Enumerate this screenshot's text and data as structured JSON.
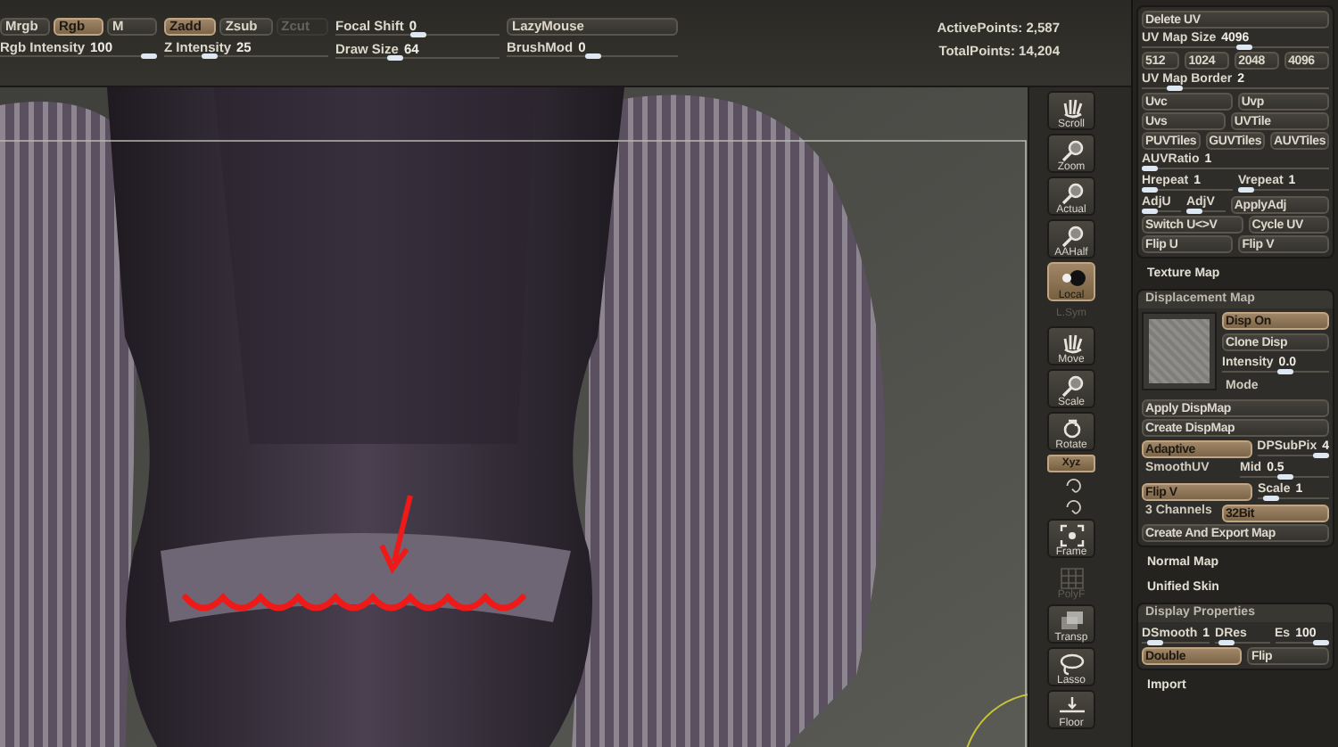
{
  "top_bar": {
    "groups": [
      {
        "rows": [
          {
            "cells": [
              {
                "kind": "button",
                "label": "Mrgb",
                "selected": false,
                "disabled": false
              },
              {
                "kind": "button",
                "label": "Rgb",
                "selected": true,
                "disabled": false
              },
              {
                "kind": "button",
                "label": "M",
                "selected": false,
                "disabled": false
              }
            ]
          },
          {
            "cells": [
              {
                "kind": "slider",
                "label": "Rgb Intensity",
                "value": "100",
                "level": 1
              }
            ]
          }
        ]
      },
      {
        "rows": [
          {
            "cells": [
              {
                "kind": "button",
                "label": "Zadd",
                "selected": true,
                "disabled": false
              },
              {
                "kind": "button",
                "label": "Zsub",
                "selected": false,
                "disabled": false
              },
              {
                "kind": "button",
                "label": "Zcut",
                "selected": false,
                "disabled": true
              }
            ]
          },
          {
            "cells": [
              {
                "kind": "slider",
                "label": "Z Intensity",
                "value": "25",
                "level": 0.25
              }
            ]
          }
        ]
      },
      {
        "rows": [
          {
            "cells": [
              {
                "kind": "slider",
                "label": "Focal Shift",
                "value": "0",
                "level": 0.5
              }
            ]
          },
          {
            "cells": [
              {
                "kind": "slider",
                "label": "Draw Size",
                "value": "64",
                "level": 0.35
              }
            ]
          }
        ]
      },
      {
        "rows": [
          {
            "cells": [
              {
                "kind": "button",
                "label": "LazyMouse",
                "selected": false,
                "disabled": false
              }
            ]
          },
          {
            "cells": [
              {
                "kind": "slider",
                "label": "BrushMod",
                "value": "0",
                "level": 0.5
              }
            ]
          }
        ]
      }
    ],
    "stats": [
      "ActivePoints: 2,587",
      "TotalPoints: 14,204"
    ]
  },
  "toolbar": [
    {
      "kind": "big",
      "label": "Scroll",
      "selected": false,
      "disabled": false
    },
    {
      "kind": "big",
      "label": "Zoom",
      "selected": false,
      "disabled": false
    },
    {
      "kind": "big",
      "label": "Actual",
      "selected": false,
      "disabled": false
    },
    {
      "kind": "big",
      "label": "AAHalf",
      "selected": false,
      "disabled": false
    },
    {
      "kind": "big",
      "label": "Local",
      "selected": true,
      "disabled": false
    },
    {
      "kind": "small",
      "label": "L.Sym",
      "selected": false,
      "disabled": true
    },
    {
      "kind": "big",
      "label": "Move",
      "selected": false,
      "disabled": false
    },
    {
      "kind": "big",
      "label": "Scale",
      "selected": false,
      "disabled": false
    },
    {
      "kind": "big",
      "label": "Rotate",
      "selected": false,
      "disabled": false
    },
    {
      "kind": "small",
      "label": "Xyz",
      "selected": true,
      "disabled": false
    },
    {
      "kind": "icon"
    },
    {
      "kind": "icon"
    },
    {
      "kind": "big",
      "label": "Frame",
      "selected": false,
      "disabled": false
    },
    {
      "kind": "big",
      "label": "PolyF",
      "selected": false,
      "disabled": true
    },
    {
      "kind": "big",
      "label": "Transp",
      "selected": false,
      "disabled": false
    },
    {
      "kind": "big",
      "label": "Lasso",
      "selected": false,
      "disabled": false
    },
    {
      "kind": "big",
      "label": "Floor",
      "selected": false,
      "disabled": false
    }
  ],
  "right_panel": [
    {
      "kind": "group",
      "rows": [
        {
          "cells": [
            {
              "kind": "button",
              "label": "Delete UV",
              "selected": false
            }
          ]
        },
        {
          "cells": [
            {
              "kind": "slider",
              "label": "UV Map Size",
              "value": "4096",
              "level": 0.55
            }
          ]
        },
        {
          "cells": [
            {
              "kind": "button",
              "label": "512",
              "selected": false
            },
            {
              "kind": "button",
              "label": "1024",
              "selected": false
            },
            {
              "kind": "button",
              "label": "2048",
              "selected": false
            },
            {
              "kind": "button",
              "label": "4096",
              "selected": false
            }
          ]
        },
        {
          "cells": [
            {
              "kind": "slider",
              "label": "UV Map Border",
              "value": "2",
              "level": 0.15
            }
          ]
        },
        {
          "cells": [
            {
              "kind": "button",
              "label": "Uvc",
              "selected": false
            },
            {
              "kind": "button",
              "label": "Uvp",
              "selected": false
            }
          ]
        },
        {
          "cells": [
            {
              "kind": "button",
              "label": "Uvs",
              "selected": false
            },
            {
              "kind": "button",
              "label": "UVTile",
              "selected": false
            }
          ]
        },
        {
          "cells": [
            {
              "kind": "button",
              "label": "PUVTiles",
              "selected": false
            },
            {
              "kind": "button",
              "label": "GUVTiles",
              "selected": false
            },
            {
              "kind": "button",
              "label": "AUVTiles",
              "selected": false
            }
          ]
        },
        {
          "cells": [
            {
              "kind": "slider",
              "label": "AUVRatio",
              "value": "1",
              "level": 0
            }
          ]
        },
        {
          "cells": [
            {
              "kind": "slider",
              "label": "Hrepeat",
              "value": "1",
              "level": 0
            },
            {
              "kind": "slider",
              "label": "Vrepeat",
              "value": "1",
              "level": 0
            }
          ]
        },
        {
          "cells": [
            {
              "kind": "slider",
              "label": "AdjU",
              "level": 0
            },
            {
              "kind": "slider",
              "label": "AdjV",
              "level": 0
            },
            {
              "kind": "button",
              "label": "ApplyAdj",
              "selected": false
            }
          ]
        },
        {
          "cells": [
            {
              "kind": "button",
              "label": "Switch U<>V",
              "selected": false
            },
            {
              "kind": "button",
              "label": "Cycle UV",
              "selected": false
            }
          ]
        },
        {
          "cells": [
            {
              "kind": "button",
              "label": "Flip U",
              "selected": false
            },
            {
              "kind": "button",
              "label": "Flip V",
              "selected": false
            }
          ]
        }
      ]
    },
    {
      "kind": "header",
      "label": "Texture Map"
    },
    {
      "kind": "group",
      "title": "Displacement Map",
      "thumb_cells": [
        {
          "kind": "button",
          "label": "Disp On",
          "selected": true
        },
        {
          "kind": "button",
          "label": "Clone Disp",
          "selected": false
        },
        {
          "kind": "slider",
          "label": "Intensity",
          "value": "0.0",
          "level": 0.6
        },
        {
          "kind": "label",
          "label": "Mode"
        }
      ],
      "rows": [
        {
          "cells": [
            {
              "kind": "button",
              "label": "Apply DispMap",
              "selected": false
            }
          ]
        },
        {
          "cells": [
            {
              "kind": "button",
              "label": "Create DispMap",
              "selected": false
            }
          ]
        },
        {
          "cells": [
            {
              "kind": "button",
              "label": "Adaptive",
              "selected": true
            },
            {
              "kind": "slider",
              "label": "DPSubPix",
              "value": "4",
              "level": 1
            }
          ]
        },
        {
          "cells": [
            {
              "kind": "label",
              "label": "SmoothUV"
            },
            {
              "kind": "slider",
              "label": "Mid",
              "value": "0.5",
              "level": 0.5
            }
          ]
        },
        {
          "cells": [
            {
              "kind": "button",
              "label": "Flip V",
              "selected": true
            },
            {
              "kind": "slider",
              "label": "Scale",
              "value": "1",
              "level": 0.1
            }
          ]
        },
        {
          "cells": [
            {
              "kind": "label",
              "label": "3 Channels"
            },
            {
              "kind": "button",
              "label": "32Bit",
              "selected": true
            }
          ]
        },
        {
          "cells": [
            {
              "kind": "button",
              "label": "Create And Export Map",
              "selected": false
            }
          ]
        }
      ]
    },
    {
      "kind": "header",
      "label": "Normal Map"
    },
    {
      "kind": "header",
      "label": "Unified Skin"
    },
    {
      "kind": "group",
      "title": "Display Properties",
      "rows": [
        {
          "cells": [
            {
              "kind": "slider",
              "label": "DSmooth",
              "value": "1",
              "level": 0.1
            },
            {
              "kind": "slider",
              "label": "DRes",
              "level": 0.1
            },
            {
              "kind": "slider",
              "label": "Es",
              "value": "100",
              "level": 1
            }
          ]
        },
        {
          "cells": [
            {
              "kind": "button",
              "label": "Double",
              "selected": true
            },
            {
              "kind": "button",
              "label": "Flip",
              "selected": false
            }
          ]
        }
      ]
    },
    {
      "kind": "header",
      "label": "Import"
    }
  ]
}
